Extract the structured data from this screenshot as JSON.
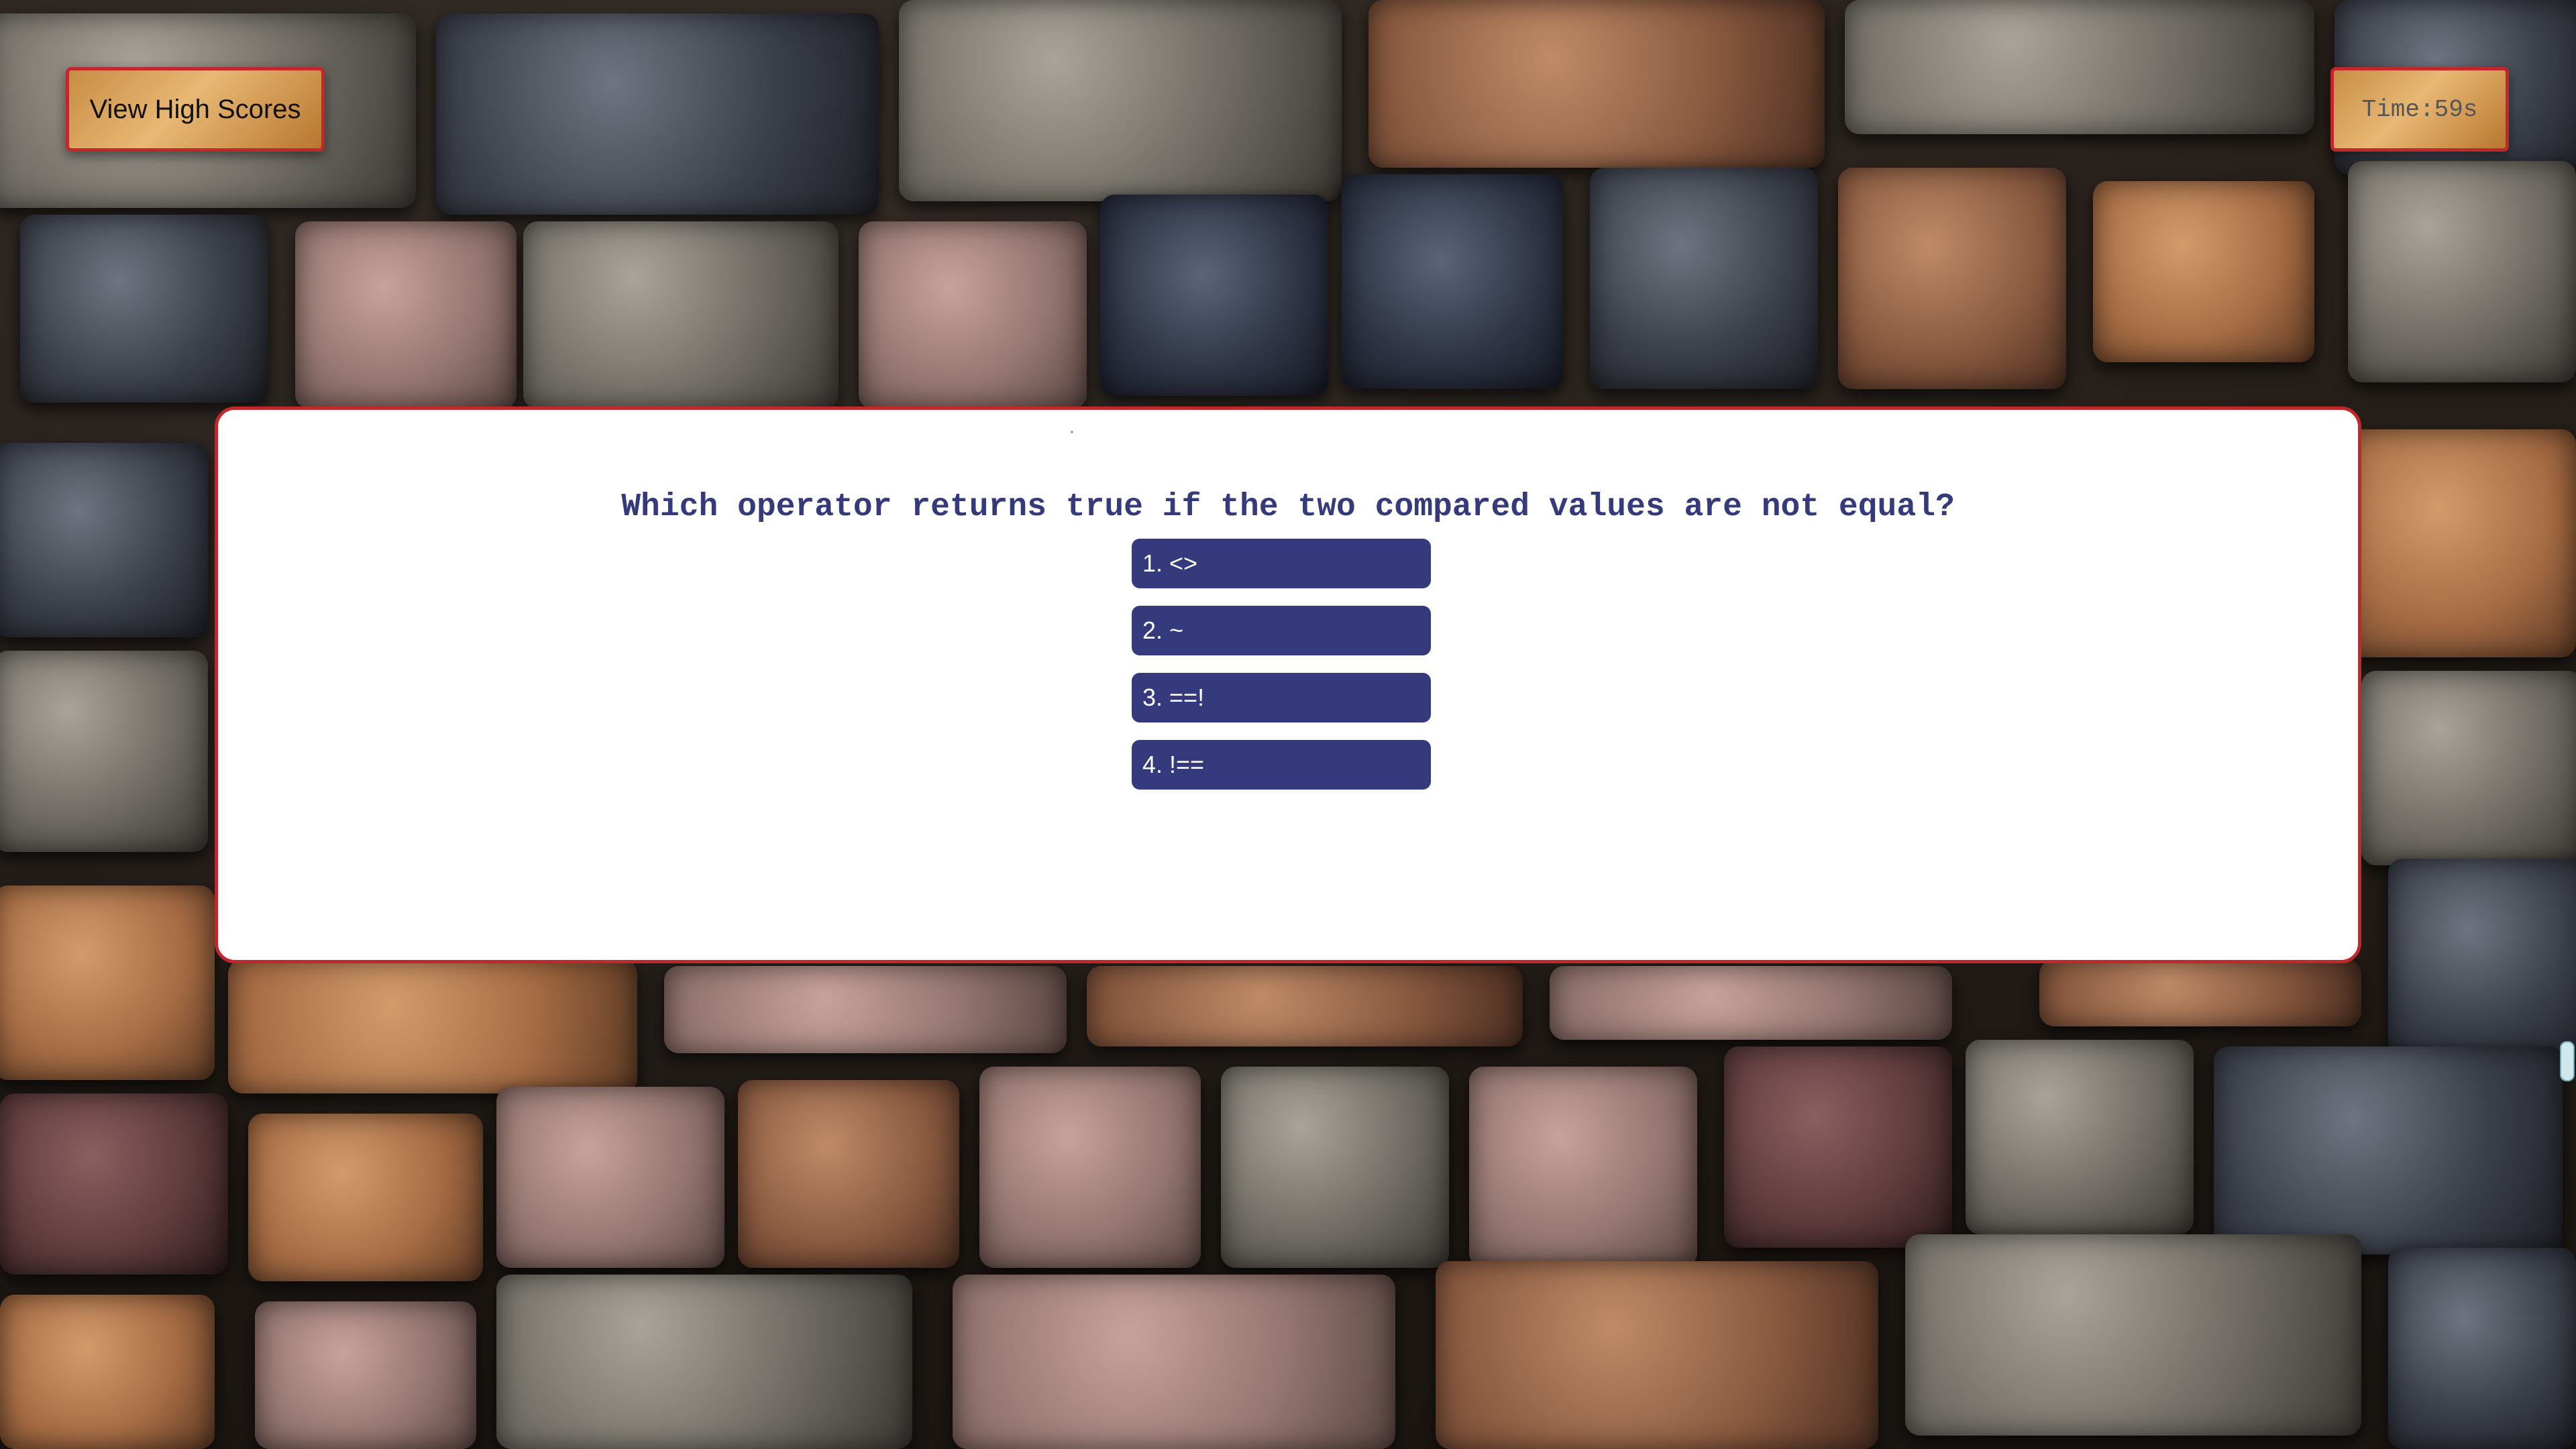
{
  "header": {
    "high_scores_label": "View High Scores",
    "timer_text": "Time:59s"
  },
  "quiz": {
    "question": "Which operator returns true if the two compared values are not equal?",
    "choices": [
      {
        "label": "1. <>"
      },
      {
        "label": "2. ~"
      },
      {
        "label": "3. ==!"
      },
      {
        "label": "4. !=="
      }
    ],
    "result_text": ""
  },
  "colors": {
    "accent_navy": "#353a7c",
    "border_red": "#c0282b",
    "button_gold": "#e8b874"
  }
}
